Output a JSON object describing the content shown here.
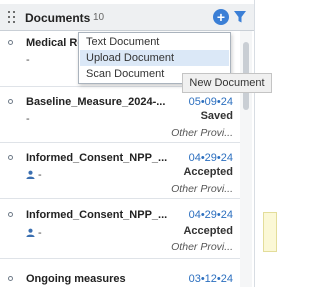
{
  "header": {
    "title": "Documents",
    "count": "10"
  },
  "new_menu": {
    "items": [
      "Text Document",
      "Upload Document",
      "Scan Document"
    ],
    "highlighted_index": 1
  },
  "tooltip": "New Document",
  "documents": [
    {
      "name": "Medical Rc",
      "sub": "-",
      "date": "",
      "status": "",
      "provider": ""
    },
    {
      "name": "Baseline_Measure_2024-...",
      "sub": "-",
      "date": "05•09•24",
      "status": "Saved",
      "provider": "Other Provi..."
    },
    {
      "name": "Informed_Consent_NPP_...",
      "sub": "-",
      "date": "04•29•24",
      "status": "Accepted",
      "provider": "Other Provi..."
    },
    {
      "name": "Informed_Consent_NPP_...",
      "sub": "-",
      "date": "04•29•24",
      "status": "Accepted",
      "provider": "Other Provi..."
    },
    {
      "name": "Ongoing measures",
      "sub": "",
      "date": "03•12•24",
      "status": "",
      "provider": ""
    }
  ],
  "colors": {
    "accent": "#3b7fd6",
    "date_text": "#2c6fbf",
    "menu_highlight": "#dbe8f7"
  },
  "icons": {
    "add": "plus-circle-icon",
    "filter": "funnel-icon",
    "drag": "drag-grip-icon",
    "person": "person-icon"
  }
}
